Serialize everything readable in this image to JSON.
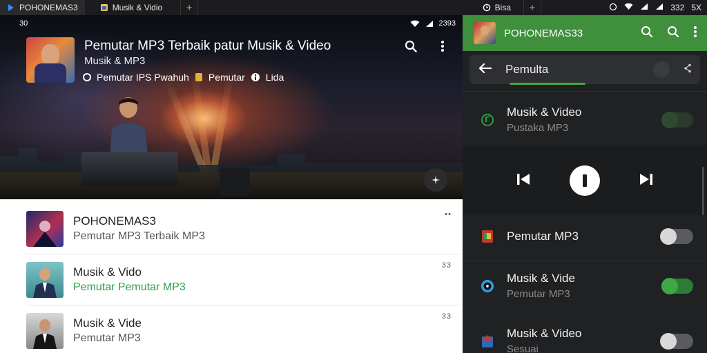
{
  "tabs": [
    {
      "label": "POHONEMAS3",
      "active": true
    },
    {
      "label": "Musik & Vidio",
      "active": false
    },
    {
      "label": "Bisa",
      "active": false
    }
  ],
  "system": {
    "time": "332",
    "extra": "5X"
  },
  "left": {
    "statusbar": {
      "left": "30",
      "right": "2393"
    },
    "hero": {
      "title": "Pemutar MP3 Terbaik patur Musik & Video",
      "subtitle": "Musik & MP3",
      "meta": [
        {
          "text": "Pemutar IPS Pwahuh"
        },
        {
          "text": "Pemutar"
        },
        {
          "text": "Lida"
        }
      ]
    },
    "list": [
      {
        "title": "POHONEMAS3",
        "subtitle": "Pemutar MP3 Terbaik MP3",
        "subtitle_green": false,
        "meta": "••"
      },
      {
        "title": "Musik & Vido",
        "subtitle": "Pemutar Pemutar MP3",
        "subtitle_green": true,
        "meta": "33"
      },
      {
        "title": "Musik & Vide",
        "subtitle": "Pemutar MP3",
        "subtitle_green": false,
        "meta": "33"
      }
    ]
  },
  "right": {
    "appbar_title": "POHONEMAS33",
    "search_label": "Pemulta",
    "now_playing": {
      "title": "Musik & Video",
      "subtitle": "Pustaka MP3"
    },
    "settings": [
      {
        "title": "Pemutar MP3",
        "subtitle": "",
        "toggle": "off",
        "icon": "app-icon-red"
      },
      {
        "title": "Musik & Vide",
        "subtitle": "Pemutar MP3",
        "toggle": "on",
        "icon": "disc-icon"
      },
      {
        "title": "Musik & Video",
        "subtitle": "Sesuai",
        "toggle": "off",
        "icon": "app-icon-blue"
      }
    ]
  }
}
